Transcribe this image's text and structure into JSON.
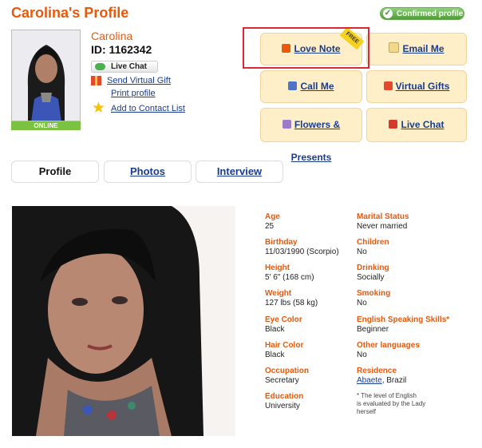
{
  "header": {
    "title": "Carolina's Profile",
    "confirmed_badge": "Confirmed profile"
  },
  "profile": {
    "name": "Carolina",
    "id_text": "ID: 1162342",
    "status_badge": "ONLINE",
    "live_chat_label": "Live Chat",
    "send_gift_link": "Send Virtual Gift",
    "print_link": "Print profile",
    "contact_list_link": "Add to Contact List"
  },
  "actions": {
    "love_note": "Love Note",
    "email_me": "Email Me",
    "call_me": "Call Me",
    "virtual_gifts": "Virtual Gifts",
    "flowers_presents": "Flowers & Presents",
    "live_chat": "Live Chat",
    "free_ribbon": "FREE"
  },
  "tabs": [
    {
      "label": "Profile"
    },
    {
      "label": "Photos"
    },
    {
      "label": "Interview"
    }
  ],
  "details_left": [
    {
      "label": "Age",
      "value": "25"
    },
    {
      "label": "Birthday",
      "value": "11/03/1990 (Scorpio)"
    },
    {
      "label": "Height",
      "value": "5' 6\" (168 cm)"
    },
    {
      "label": "Weight",
      "value": "127 lbs (58 kg)"
    },
    {
      "label": "Eye Color",
      "value": "Black"
    },
    {
      "label": "Hair Color",
      "value": "Black"
    },
    {
      "label": "Occupation",
      "value": "Secretary"
    },
    {
      "label": "Education",
      "value": "University"
    }
  ],
  "details_right": [
    {
      "label": "Marital Status",
      "value": "Never married"
    },
    {
      "label": "Children",
      "value": "No"
    },
    {
      "label": "Drinking",
      "value": "Socially"
    },
    {
      "label": "Smoking",
      "value": "No"
    },
    {
      "label": "English Speaking Skills*",
      "value": "Beginner"
    },
    {
      "label": "Other languages",
      "value": "No"
    },
    {
      "label": "Residence",
      "value_link": "Abaete",
      "value_rest": ", Brazil"
    }
  ],
  "footnote": {
    "line1": "* The level of English",
    "line2": "is evaluated by the Lady",
    "line3": "herself"
  },
  "colors": {
    "accent": "#e8590c",
    "link": "#1a3c8c",
    "tile_bg": "#ffefc9",
    "online": "#7cc242",
    "highlight": "#d9283a"
  }
}
